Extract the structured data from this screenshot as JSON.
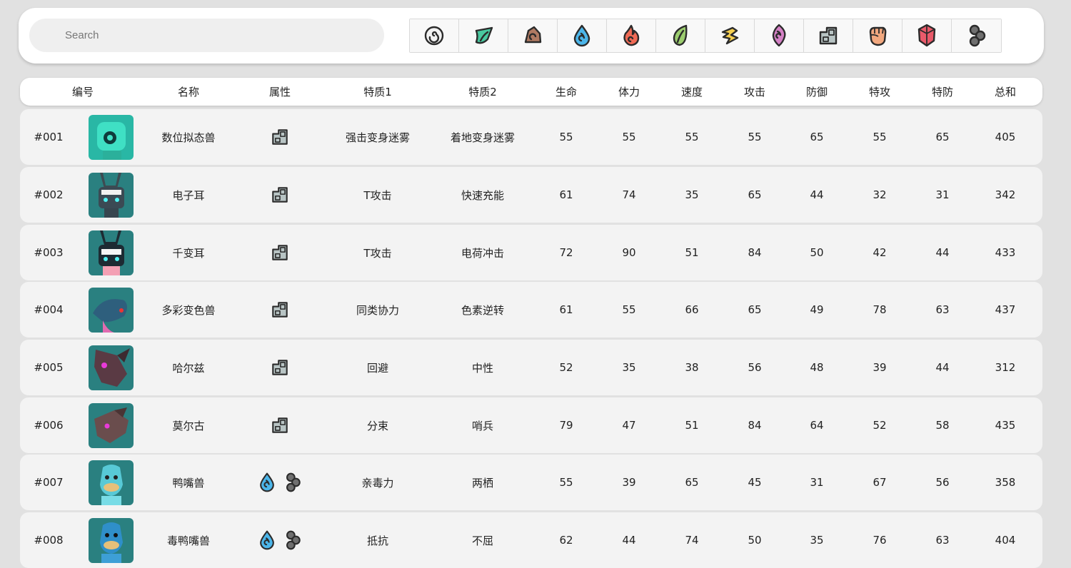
{
  "search": {
    "placeholder": "Search"
  },
  "type_filters": [
    {
      "name": "normal-type-icon",
      "color": "#f2f2f2"
    },
    {
      "name": "grass-type-icon",
      "color": "#49c9a0"
    },
    {
      "name": "ground-type-icon",
      "color": "#b07a62"
    },
    {
      "name": "water-type-icon",
      "color": "#4cb6ea"
    },
    {
      "name": "fire-type-icon",
      "color": "#ef6a55"
    },
    {
      "name": "leaf-type-icon",
      "color": "#9ccd6f"
    },
    {
      "name": "electric-type-icon",
      "color": "#f6cf4f"
    },
    {
      "name": "psychic-type-icon",
      "color": "#d481c5"
    },
    {
      "name": "mechanical-type-icon",
      "color": "#b8c4c4"
    },
    {
      "name": "fighting-type-icon",
      "color": "#f2a87f"
    },
    {
      "name": "crystal-type-icon",
      "color": "#ea5a6a"
    },
    {
      "name": "poison-type-icon",
      "color": "#6f6f6f"
    }
  ],
  "table": {
    "headers": [
      "编号",
      "名称",
      "属性",
      "特质1",
      "特质2",
      "生命",
      "体力",
      "速度",
      "攻击",
      "防御",
      "特攻",
      "特防",
      "总和"
    ],
    "rows": [
      {
        "id": "#001",
        "name": "数位拟态兽",
        "types": [
          "mechanical"
        ],
        "trait1": "强击变身迷雾",
        "trait2": "着地变身迷雾",
        "hp": "55",
        "sta": "55",
        "spd": "55",
        "atk": "55",
        "def": "65",
        "spatk": "55",
        "spdef": "65",
        "total": "405",
        "avatar": "#29b7a5"
      },
      {
        "id": "#002",
        "name": "电子耳",
        "types": [
          "mechanical"
        ],
        "trait1": "T攻击",
        "trait2": "快速充能",
        "hp": "61",
        "sta": "74",
        "spd": "35",
        "atk": "65",
        "def": "44",
        "spatk": "32",
        "spdef": "31",
        "total": "342",
        "avatar": "#2a8080"
      },
      {
        "id": "#003",
        "name": "千变耳",
        "types": [
          "mechanical"
        ],
        "trait1": "T攻击",
        "trait2": "电荷冲击",
        "hp": "72",
        "sta": "90",
        "spd": "51",
        "atk": "84",
        "def": "50",
        "spatk": "42",
        "spdef": "44",
        "total": "433",
        "avatar": "#2a8080"
      },
      {
        "id": "#004",
        "name": "多彩变色兽",
        "types": [
          "mechanical"
        ],
        "trait1": "同类协力",
        "trait2": "色素逆转",
        "hp": "61",
        "sta": "55",
        "spd": "66",
        "atk": "65",
        "def": "49",
        "spatk": "78",
        "spdef": "63",
        "total": "437",
        "avatar": "#2a8080"
      },
      {
        "id": "#005",
        "name": "哈尔兹",
        "types": [
          "mechanical"
        ],
        "trait1": "回避",
        "trait2": "中性",
        "hp": "52",
        "sta": "35",
        "spd": "38",
        "atk": "56",
        "def": "48",
        "spatk": "39",
        "spdef": "44",
        "total": "312",
        "avatar": "#2a8080"
      },
      {
        "id": "#006",
        "name": "莫尔古",
        "types": [
          "mechanical"
        ],
        "trait1": "分束",
        "trait2": "哨兵",
        "hp": "79",
        "sta": "47",
        "spd": "51",
        "atk": "84",
        "def": "64",
        "spatk": "52",
        "spdef": "58",
        "total": "435",
        "avatar": "#2a8080"
      },
      {
        "id": "#007",
        "name": "鸭嘴兽",
        "types": [
          "water",
          "poison"
        ],
        "trait1": "亲毒力",
        "trait2": "两栖",
        "hp": "55",
        "sta": "39",
        "spd": "65",
        "atk": "45",
        "def": "31",
        "spatk": "67",
        "spdef": "56",
        "total": "358",
        "avatar": "#2a8080"
      },
      {
        "id": "#008",
        "name": "毒鸭嘴兽",
        "types": [
          "water",
          "poison"
        ],
        "trait1": "抵抗",
        "trait2": "不屈",
        "hp": "62",
        "sta": "44",
        "spd": "74",
        "atk": "50",
        "def": "35",
        "spatk": "76",
        "spdef": "63",
        "total": "404",
        "avatar": "#2a8080"
      }
    ]
  }
}
